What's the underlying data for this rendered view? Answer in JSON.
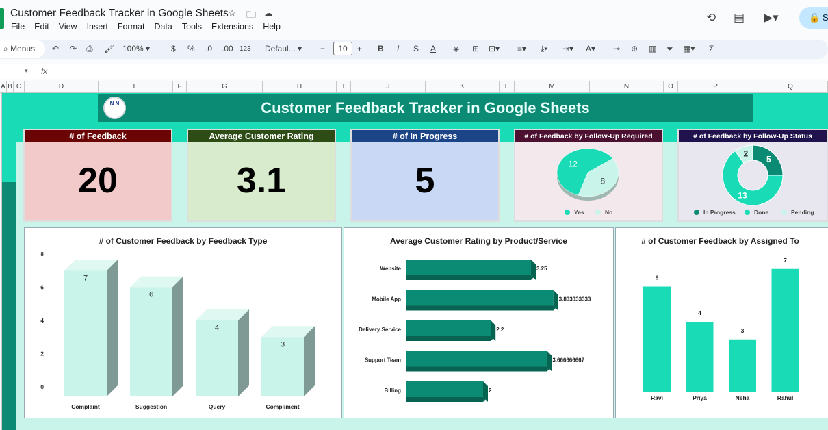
{
  "window": {
    "doc_title": "Customer Feedback Tracker in Google Sheets",
    "share_label": "S"
  },
  "menu": [
    "File",
    "Edit",
    "View",
    "Insert",
    "Format",
    "Data",
    "Tools",
    "Extensions",
    "Help"
  ],
  "toolbar": {
    "menus_label": "Menus",
    "zoom": "100%",
    "currency": "$",
    "percent": "%",
    "dec_decrease": ".0",
    "dec_increase": ".00",
    "number_format": "123",
    "font": "Defaul...",
    "font_size": "10",
    "bold": "B",
    "italic": "I",
    "strike": "S",
    "text_color": "A"
  },
  "formula_bar": {
    "fx": "fx"
  },
  "columns": [
    "A",
    "B",
    "C",
    "D",
    "E",
    "F",
    "G",
    "H",
    "I",
    "J",
    "K",
    "L",
    "M",
    "N",
    "O",
    "P",
    "Q"
  ],
  "dashboard": {
    "title": "Customer Feedback Tracker in Google Sheets",
    "logo_text": "N N",
    "kpis": [
      {
        "label": "# of Feedback",
        "value": "20",
        "head_color": "#6b0505",
        "bg": "#f3caca"
      },
      {
        "label": "Average Customer Rating",
        "value": "3.1",
        "head_color": "#2e4d16",
        "bg": "#d8eccd"
      },
      {
        "label": "# of In Progress",
        "value": "5",
        "head_color": "#1c4587",
        "bg": "#c9d9f5"
      }
    ],
    "pie_followup": {
      "title": "# of Feedback by Follow-Up Required",
      "head_color": "#4c1130",
      "slices": [
        {
          "name": "Yes",
          "value": 12,
          "color": "#19dcb6"
        },
        {
          "name": "No",
          "value": 8,
          "color": "#c8f4ea"
        }
      ]
    },
    "donut_status": {
      "title": "# of Feedback by Follow-Up Status",
      "head_color": "#20124d",
      "slices": [
        {
          "name": "In Progress",
          "value": 5,
          "color": "#0b8a74"
        },
        {
          "name": "Done",
          "value": 13,
          "color": "#19dcb6"
        },
        {
          "name": "Pending",
          "value": 2,
          "color": "#c8f4ea"
        }
      ]
    }
  },
  "chart_data": [
    {
      "type": "bar",
      "title": "# of Customer Feedback by Feedback Type",
      "categories": [
        "Complaint",
        "Suggestion",
        "Query",
        "Compliment"
      ],
      "values": [
        7,
        6,
        4,
        3
      ],
      "ylim": [
        0,
        8
      ],
      "yticks": [
        "0",
        "2",
        "4",
        "6",
        "8"
      ],
      "color": "#c8f4ea"
    },
    {
      "type": "bar",
      "orientation": "horizontal",
      "title": "Average Customer Rating by Product/Service",
      "categories": [
        "Website",
        "Mobile App",
        "Delivery Service",
        "Support Team",
        "Billing"
      ],
      "values": [
        3.25,
        3.833333333,
        2.2,
        3.666666667,
        2
      ],
      "value_labels": [
        "3.25",
        "3.833333333",
        "2.2",
        "3.666666667",
        "2"
      ],
      "xlim": [
        0,
        4
      ],
      "color": "#0b8a74"
    },
    {
      "type": "bar",
      "title": "# of Customer Feedback by Assigned To",
      "categories": [
        "Ravi",
        "Priya",
        "Neha",
        "Rahul"
      ],
      "values": [
        6,
        4,
        3,
        7
      ],
      "value_labels": [
        "6",
        "4",
        "3",
        "7"
      ],
      "ylim": [
        0,
        8
      ],
      "color": "#19dcb6"
    }
  ]
}
